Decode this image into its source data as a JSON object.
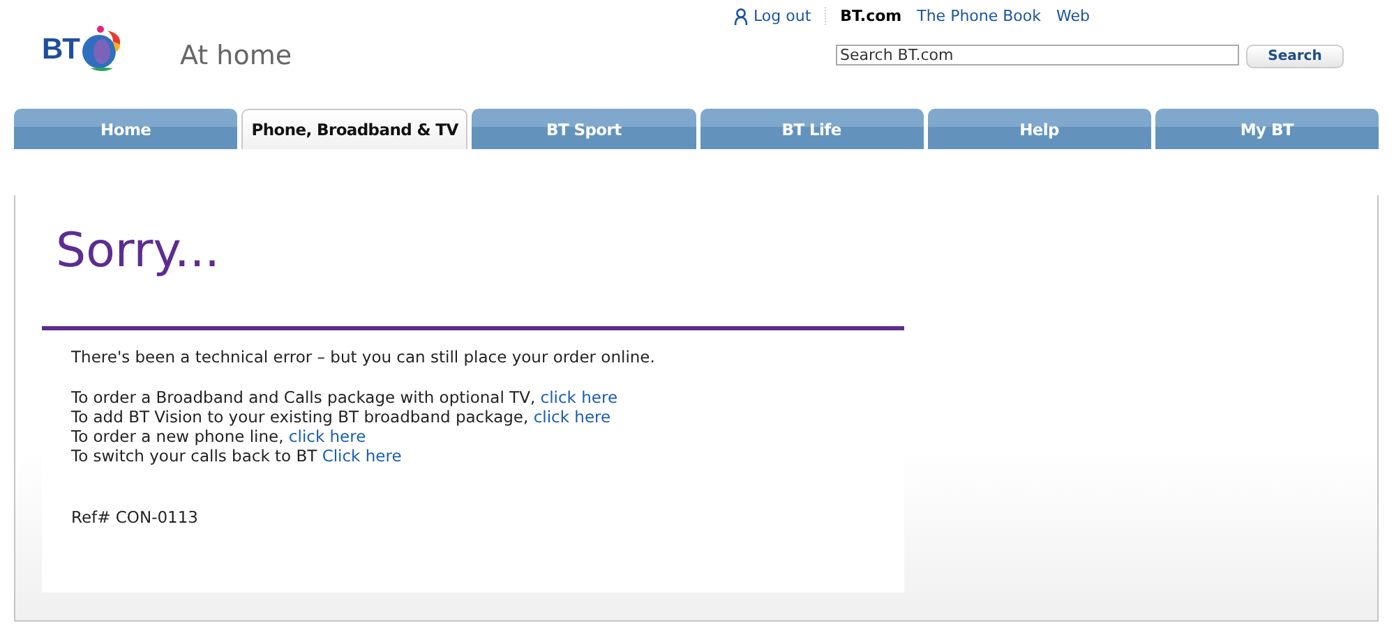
{
  "header": {
    "logo": "BT",
    "site_name": "At home",
    "account_link": "Log out",
    "site_links": [
      {
        "label": "BT.com",
        "selected": true
      },
      {
        "label": "The Phone Book",
        "selected": false
      },
      {
        "label": "Web",
        "selected": false
      }
    ],
    "search": {
      "placeholder": "Search BT.com",
      "button": "Search"
    }
  },
  "tabs": [
    {
      "label": "Home",
      "selected": false
    },
    {
      "label": "Phone, Broadband & TV",
      "selected": true
    },
    {
      "label": "BT Sport",
      "selected": false
    },
    {
      "label": "BT Life",
      "selected": false
    },
    {
      "label": "Help",
      "selected": false
    },
    {
      "label": "My BT",
      "selected": false
    }
  ],
  "content": {
    "title": "Sorry...",
    "intro": "There's been a technical error – but you can still place your order online.",
    "options": [
      {
        "text": "To order a Broadband and Calls package with optional TV,",
        "link": "click here"
      },
      {
        "text": "To add BT Vision to your existing BT broadband package,",
        "link": "click here"
      },
      {
        "text": "To order a new phone line,",
        "link": "click here"
      },
      {
        "text": "To switch your calls back to BT",
        "link": "Click here"
      }
    ],
    "reference": "Ref# CON-0113"
  }
}
